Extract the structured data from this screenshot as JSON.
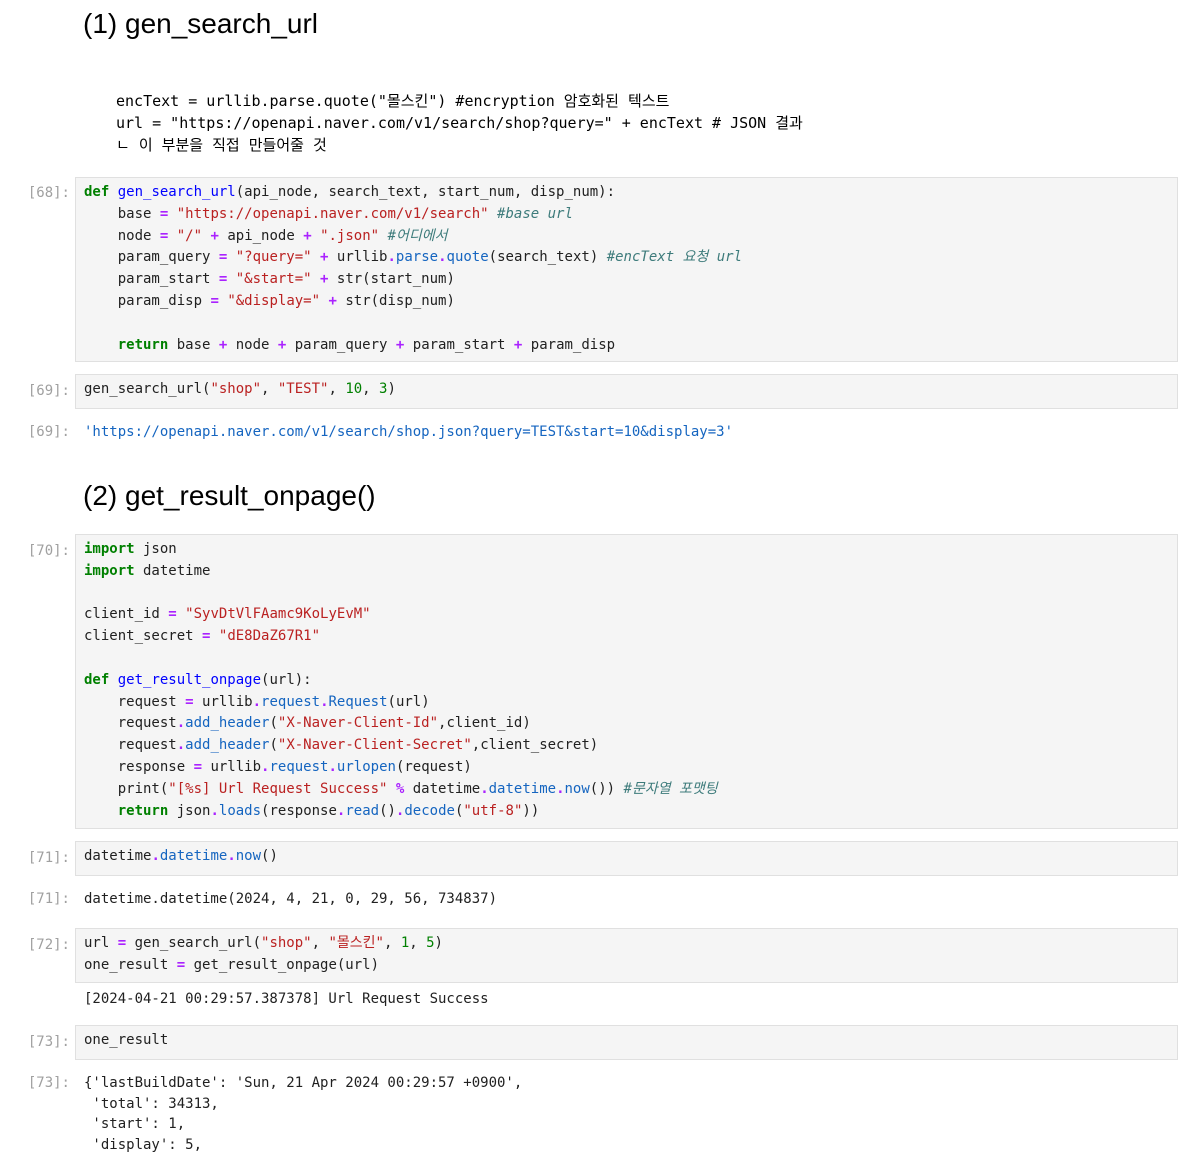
{
  "heading1": "(1) gen_search_url",
  "md_code_lines": [
    "encText = urllib.parse.quote(\"몰스킨\") #encryption 암호화된 텍스트",
    "url = \"https://openapi.naver.com/v1/search/shop?query=\" + encText # JSON 결과",
    "ㄴ 이 부분을 직접 만들어줄 것"
  ],
  "cell68": {
    "prompt": "[68]:",
    "s_base_url": "\"https://openapi.naver.com/v1/search\"",
    "c_base_url": "#base url",
    "s_slash": "\"/\"",
    "s_json": "\".json\"",
    "c_where": "#어디에서",
    "s_query": "\"?query=\"",
    "c_enctext": "#encText 요청 url",
    "s_start": "\"&start=\"",
    "s_display": "\"&display=\""
  },
  "cell69": {
    "prompt": "[69]:",
    "a1": "\"shop\"",
    "a2": "\"TEST\"",
    "a3": "10",
    "a4": "3",
    "out_prompt": "[69]:",
    "output": "'https://openapi.naver.com/v1/search/shop.json?query=TEST&start=10&display=3'"
  },
  "heading2": "(2) get_result_onpage()",
  "cell70": {
    "prompt": "[70]:",
    "client_id": "\"SyvDtVlFAamc9KoLyEvM\"",
    "client_secret": "\"dE8DaZ67R1\"",
    "h_id": "\"X-Naver-Client-Id\"",
    "h_secret": "\"X-Naver-Client-Secret\"",
    "s_print": "\"[%s] Url Request Success\"",
    "c_format": "#문자열 포맷팅",
    "s_utf8": "\"utf-8\""
  },
  "cell71": {
    "prompt": "[71]:",
    "out_prompt": "[71]:",
    "output": "datetime.datetime(2024, 4, 21, 0, 29, 56, 734837)"
  },
  "cell72": {
    "prompt": "[72]:",
    "a1": "\"shop\"",
    "a2": "\"몰스킨\"",
    "a3": "1",
    "a4": "5",
    "stdout": "[2024-04-21 00:29:57.387378] Url Request Success"
  },
  "cell73": {
    "prompt": "[73]:",
    "code": "one_result",
    "out_prompt": "[73]:",
    "output_lines": [
      "{'lastBuildDate': 'Sun, 21 Apr 2024 00:29:57 +0900',",
      " 'total': 34313,",
      " 'start': 1,",
      " 'display': 5,"
    ]
  }
}
